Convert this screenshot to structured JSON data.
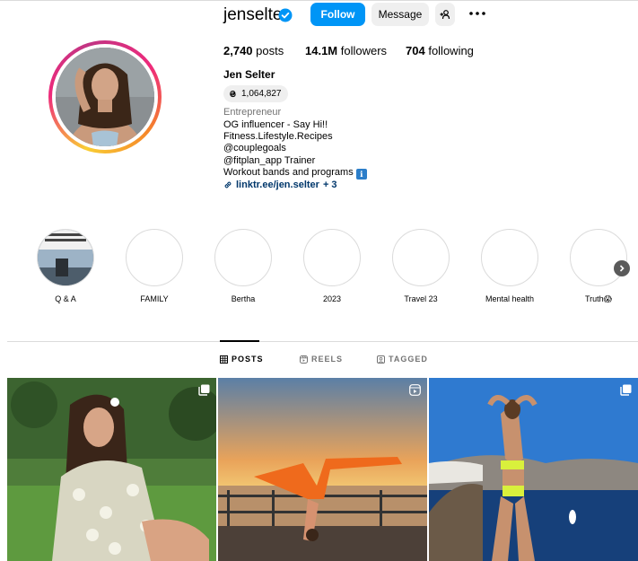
{
  "profile": {
    "username": "jenselter",
    "follow_label": "Follow",
    "message_label": "Message",
    "stats": {
      "posts_count": "2,740",
      "posts_label": "posts",
      "followers_count": "14.1M",
      "followers_label": "followers",
      "following_count": "704",
      "following_label": "following"
    },
    "full_name": "Jen Selter",
    "threads_count": "1,064,827",
    "category": "Entrepreneur",
    "bio_lines": [
      "OG influencer - Say Hi!!",
      "Fitness.Lifestyle.Recipes",
      "@couplegoals",
      "@fitplan_app Trainer",
      "Workout bands and programs"
    ],
    "bio_emoji": "ℹ",
    "link_text": "linktr.ee/jen.selter",
    "link_more": "+ 3"
  },
  "highlights": [
    {
      "label": "Q & A"
    },
    {
      "label": "FAMILY"
    },
    {
      "label": "Bertha"
    },
    {
      "label": "2023"
    },
    {
      "label": "Travel 23"
    },
    {
      "label": "Mental health"
    },
    {
      "label": "Truth😱"
    }
  ],
  "tabs": [
    {
      "label": "POSTS",
      "icon": "grid-icon",
      "active": true
    },
    {
      "label": "REELS",
      "icon": "reels-icon",
      "active": false
    },
    {
      "label": "TAGGED",
      "icon": "tagged-icon",
      "active": false
    }
  ],
  "posts": [
    {
      "type": "carousel",
      "icon": "carousel-icon"
    },
    {
      "type": "reel",
      "icon": "reel-icon"
    },
    {
      "type": "carousel",
      "icon": "carousel-icon"
    }
  ],
  "colors": {
    "accent": "#0095f6",
    "link": "#00376b",
    "muted": "#737373"
  }
}
